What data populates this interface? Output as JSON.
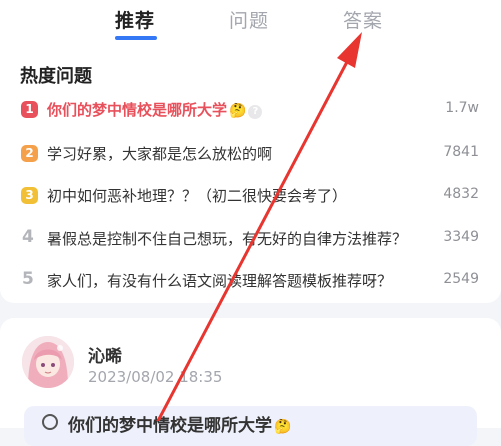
{
  "tabs": [
    {
      "label": "推荐",
      "active": true
    },
    {
      "label": "问题",
      "active": false
    },
    {
      "label": "答案",
      "active": false
    }
  ],
  "hot_section": {
    "title": "热度问题",
    "items": [
      {
        "rank": "1",
        "text": "你们的梦中情校是哪所大学",
        "emoji": "🤔",
        "help": "?",
        "count": "1.7w"
      },
      {
        "rank": "2",
        "text": "学习好累，大家都是怎么放松的啊",
        "count": "7841"
      },
      {
        "rank": "3",
        "text": "初中如何恶补地理？？（初二很快要会考了）",
        "count": "4832"
      },
      {
        "rank": "4",
        "text": "暑假总是控制不住自己想玩，有无好的自律方法推荐？",
        "count": "3349"
      },
      {
        "rank": "5",
        "text": "家人们，有没有什么语文阅读理解答题模板推荐呀？",
        "count": "2549"
      }
    ]
  },
  "post": {
    "author": "沁晞",
    "time": "2023/08/02 18:35",
    "quote": "你们的梦中情校是哪所大学",
    "quote_emoji": "🤔"
  },
  "colors": {
    "accent": "#3478f6",
    "hot_text": "#e8505b",
    "rank1": "#e8505b",
    "rank2": "#f5a04a",
    "rank3": "#f2c037",
    "annotation_arrow": "#e8352f"
  },
  "icons": {
    "quote": "circle-icon",
    "annotation": "red-arrow-icon"
  }
}
